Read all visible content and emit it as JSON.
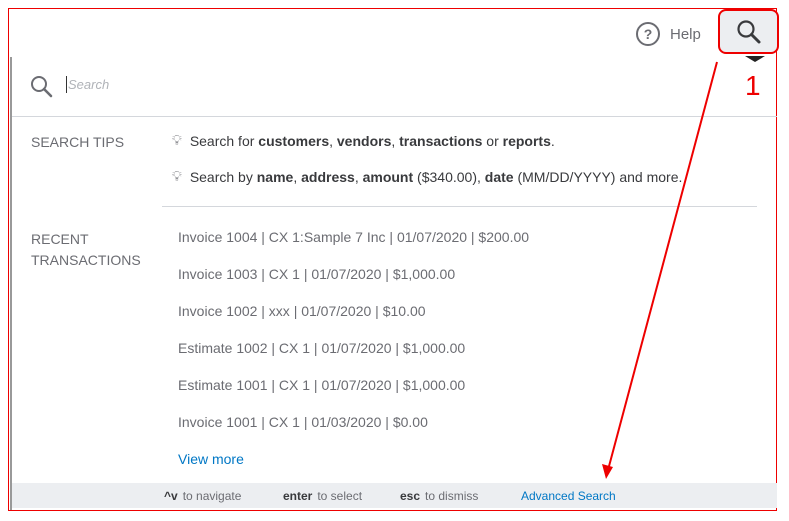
{
  "header": {
    "help_label": "Help"
  },
  "search": {
    "placeholder": "Search"
  },
  "tips": {
    "label": "SEARCH TIPS",
    "lines": [
      {
        "parts": [
          "Search for ",
          "customers",
          ", ",
          "vendors",
          ", ",
          "transactions",
          " or ",
          "reports",
          "."
        ]
      },
      {
        "parts": [
          "Search by ",
          "name",
          ", ",
          "address",
          ", ",
          "amount",
          " ($340.00), ",
          "date",
          " (MM/DD/YYYY) and more."
        ]
      }
    ]
  },
  "recent": {
    "label_line1": "RECENT",
    "label_line2": "TRANSACTIONS",
    "items": [
      "Invoice 1004 | CX 1:Sample 7 Inc | 01/07/2020 | $200.00",
      "Invoice 1003 | CX 1 | 01/07/2020 | $1,000.00",
      "Invoice 1002 | xxx | 01/07/2020 | $10.00",
      "Estimate 1002 | CX 1 | 01/07/2020 | $1,000.00",
      "Estimate 1001 | CX 1 | 01/07/2020 | $1,000.00",
      "Invoice 1001 | CX 1 | 01/03/2020 | $0.00"
    ],
    "view_more": "View more"
  },
  "footer": {
    "nav_keys": "^v",
    "nav": "to navigate",
    "enter_key": "enter",
    "enter": "to select",
    "esc_key": "esc",
    "esc": "to dismiss",
    "advanced": "Advanced Search"
  },
  "annotation": {
    "step": "1",
    "color": "#ee0000"
  }
}
